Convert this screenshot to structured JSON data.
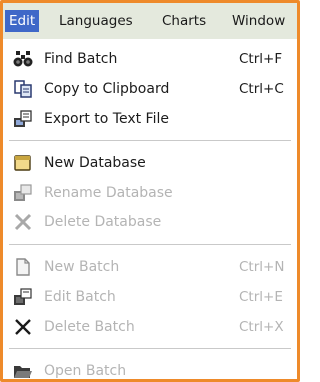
{
  "menubar": {
    "items": [
      {
        "label": "Edit",
        "active": true
      },
      {
        "label": "Languages"
      },
      {
        "label": "Charts"
      },
      {
        "label": "Window"
      }
    ]
  },
  "edit_menu": {
    "find_batch": {
      "label": "Find Batch",
      "shortcut": "Ctrl+F",
      "icon": "binoculars-icon",
      "enabled": true
    },
    "copy_to_clipboard": {
      "label": "Copy to Clipboard",
      "shortcut": "Ctrl+C",
      "icon": "copy-icon",
      "enabled": true
    },
    "export_to_text_file": {
      "label": "Export to Text File",
      "icon": "export-icon",
      "enabled": true
    },
    "new_database": {
      "label": "New Database",
      "icon": "database-icon",
      "enabled": true
    },
    "rename_database": {
      "label": "Rename Database",
      "icon": "rename-icon",
      "enabled": false
    },
    "delete_database": {
      "label": "Delete Database",
      "icon": "delete-x-icon",
      "enabled": false
    },
    "new_batch": {
      "label": "New Batch",
      "shortcut": "Ctrl+N",
      "icon": "document-icon",
      "enabled": false
    },
    "edit_batch": {
      "label": "Edit Batch",
      "shortcut": "Ctrl+E",
      "icon": "edit-icon",
      "enabled": false
    },
    "delete_batch": {
      "label": "Delete Batch",
      "shortcut": "Ctrl+X",
      "icon": "delete-x-icon",
      "enabled": false
    },
    "open_batch": {
      "label": "Open Batch",
      "icon": "open-folder-icon",
      "enabled": false
    }
  },
  "colors": {
    "frame_border": "#ee8a2a",
    "menubar_bg": "#e4e9dd",
    "active_menu_bg": "#3f68c8",
    "disabled_text": "#b4b4b4"
  }
}
